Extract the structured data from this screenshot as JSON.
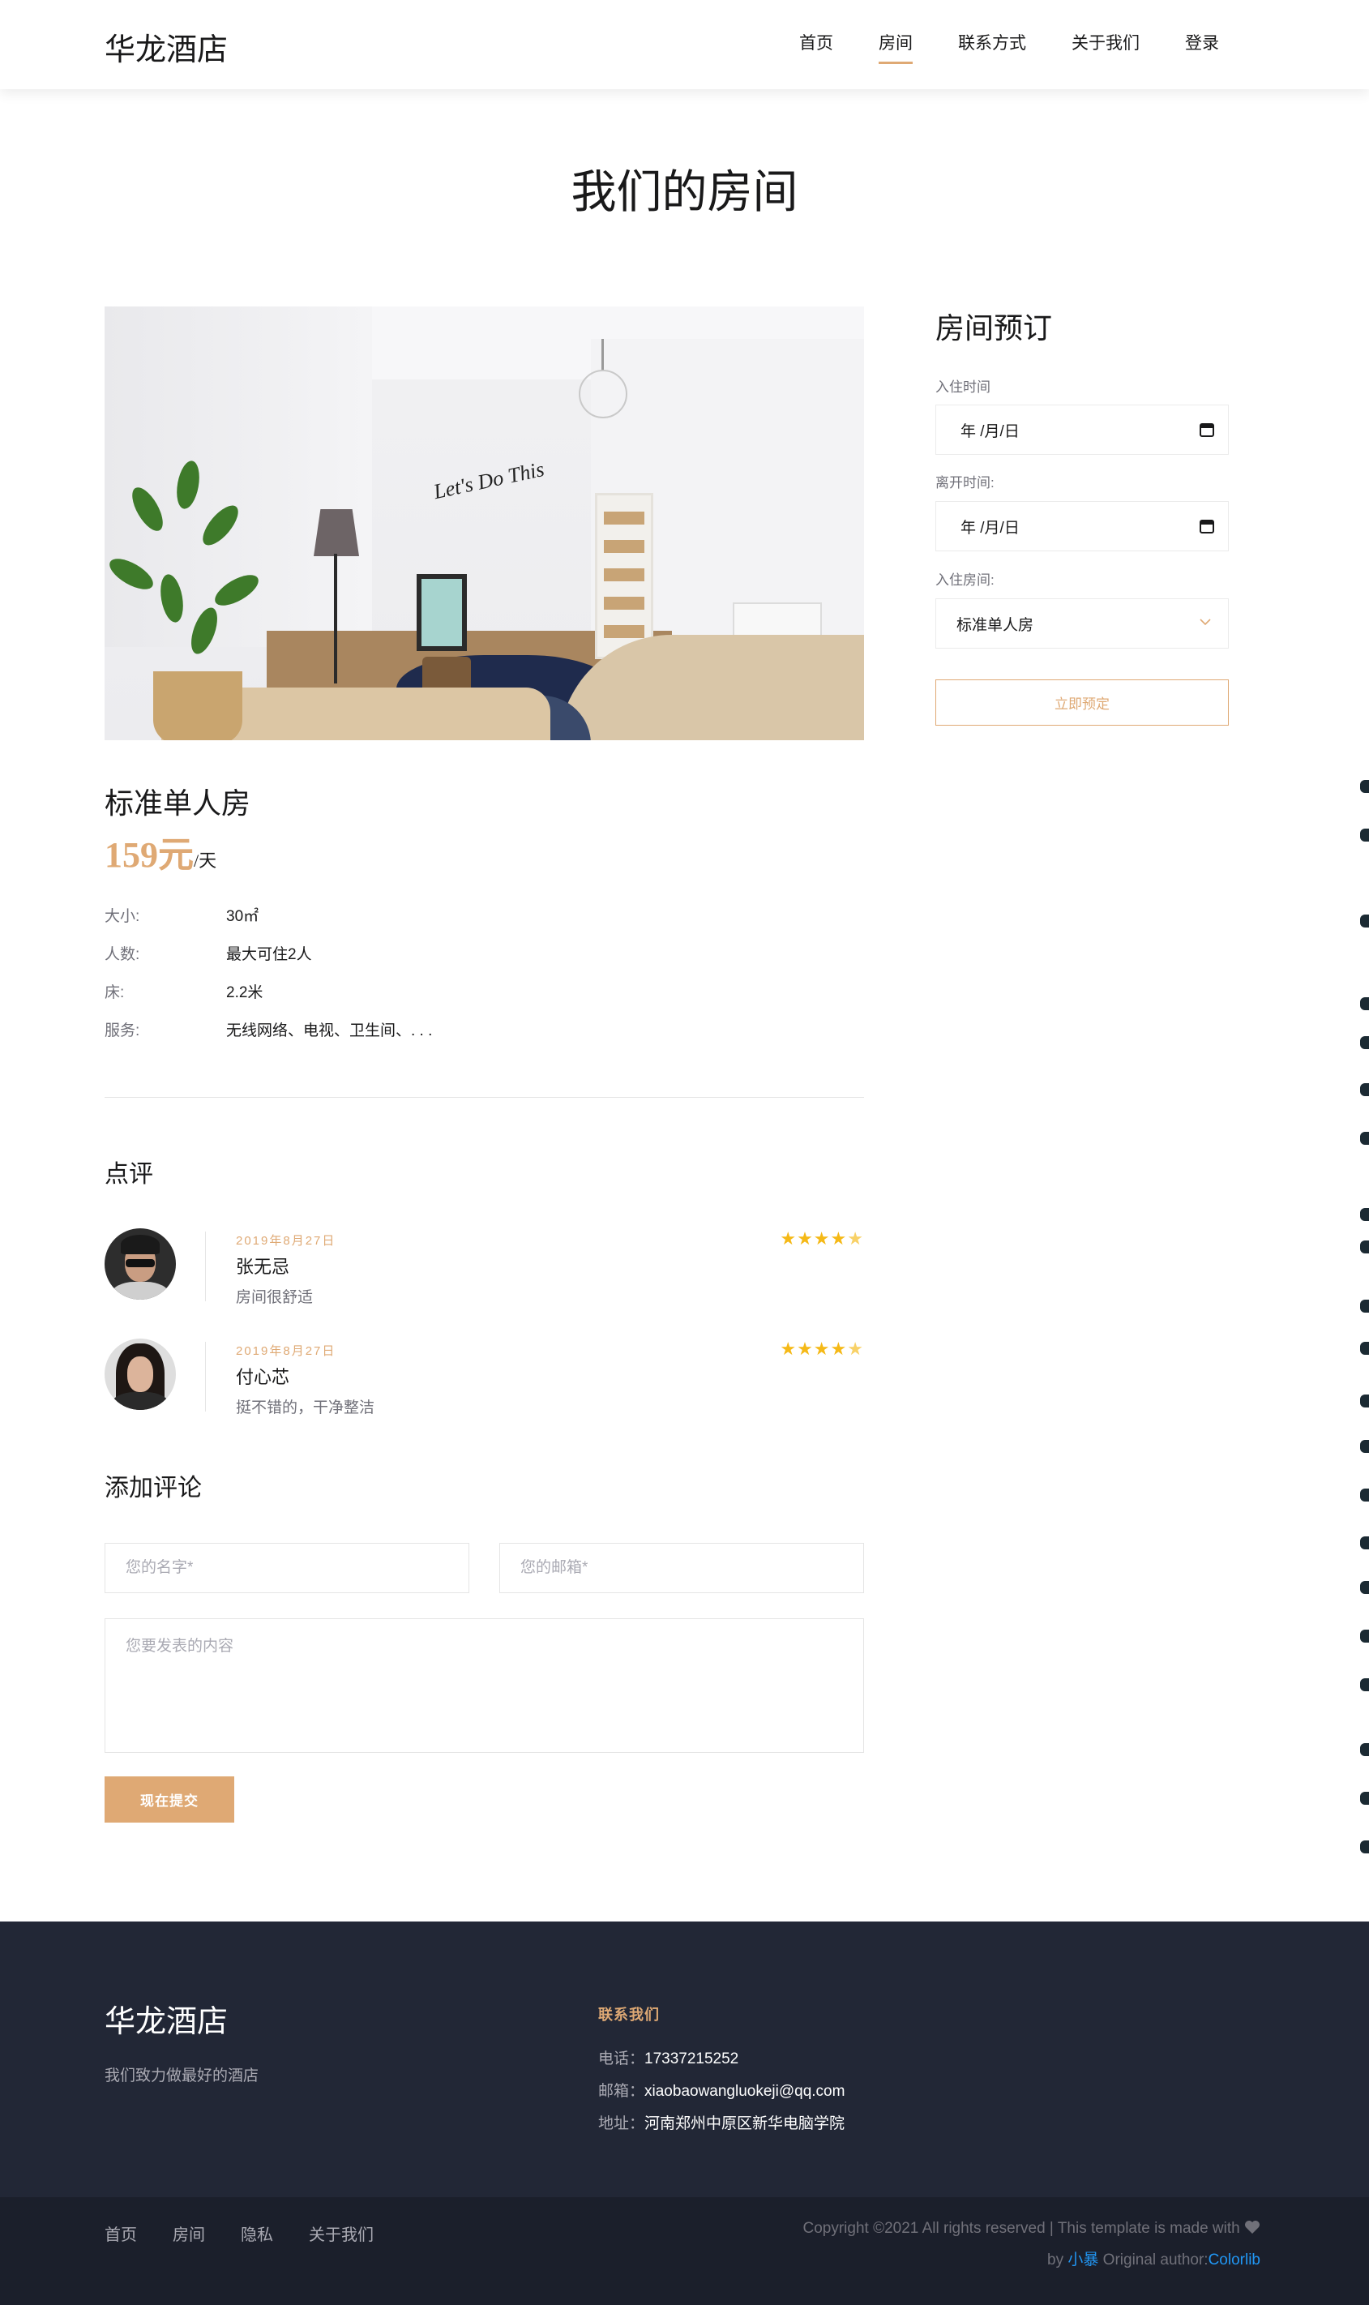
{
  "header": {
    "logo": "华龙酒店",
    "nav": [
      "首页",
      "房间",
      "联系方式",
      "关于我们",
      "登录"
    ],
    "active_index": 1
  },
  "page_title": "我们的房间",
  "room": {
    "name": "标准单人房",
    "price": "159元",
    "price_unit": "/天",
    "specs": [
      {
        "label": "大小:",
        "value": "30㎡"
      },
      {
        "label": "人数:",
        "value": "最大可住2人"
      },
      {
        "label": "床:",
        "value": "2.2米"
      },
      {
        "label": "服务:",
        "value": "无线网络、电视、卫生间、. . ."
      }
    ],
    "image_text": "Let's Do This"
  },
  "reviews": {
    "title": "点评",
    "items": [
      {
        "date": "2019年8月27日",
        "name": "张无忌",
        "text": "房间很舒适",
        "rating": 4.5
      },
      {
        "date": "2019年8月27日",
        "name": "付心芯",
        "text": "挺不错的，干净整洁",
        "rating": 4.5
      }
    ]
  },
  "comment_form": {
    "title": "添加评论",
    "name_placeholder": "您的名字*",
    "email_placeholder": "您的邮箱*",
    "content_placeholder": "您要发表的内容",
    "submit_label": "现在提交"
  },
  "booking": {
    "title": "房间预订",
    "checkin_label": "入住时间",
    "checkin_value": "年 /月/日",
    "checkout_label": "离开时间:",
    "checkout_value": "年 /月/日",
    "room_label": "入住房间:",
    "room_value": "标准单人房",
    "submit_label": "立即预定"
  },
  "footer": {
    "logo": "华龙酒店",
    "slogan": "我们致力做最好的酒店",
    "contact_title": "联系我们",
    "phone_label": "电话：",
    "phone": "17337215252",
    "email_label": "邮箱：",
    "email": "xiaobaowangluokeji@qq.com",
    "address_label": "地址：",
    "address": "河南郑州中原区新华电脑学院",
    "nav": [
      "首页",
      "房间",
      "隐私",
      "关于我们"
    ],
    "copyright_line1": "Copyright ©2021 All rights reserved | This template is made with",
    "copyright_by": "by",
    "copyright_author": "小暴",
    "copyright_original": "Original author:",
    "copyright_link": "Colorlib"
  },
  "colors": {
    "accent": "#dfa974",
    "footer_bg": "#222736",
    "footer_bottom_bg": "#1b1f2b",
    "star": "#f5b917",
    "link": "#2196f3"
  }
}
